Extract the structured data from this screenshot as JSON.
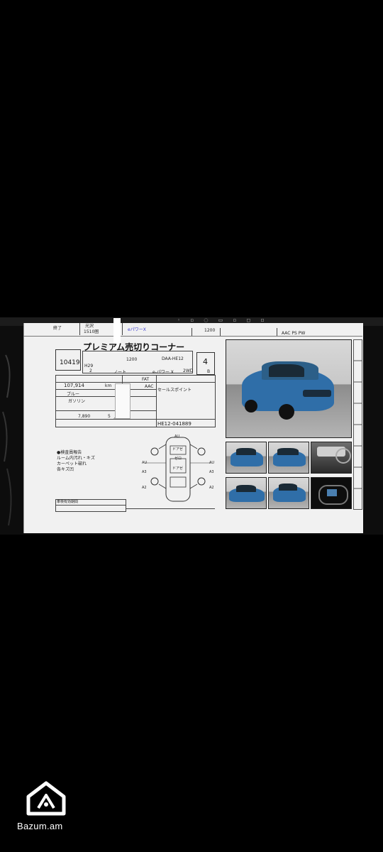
{
  "header": {
    "cell1": "終了",
    "cell2": "光沢",
    "cell3": "1510圏",
    "cell4": "eパワーX",
    "cell5": "1200",
    "equipment": "AAC PS PW"
  },
  "sheet": {
    "lot_number": "10419",
    "title": "プレミアム売切りコーナー",
    "displacement": "1200",
    "model_code": "DAA-HE12",
    "year_label": "H29",
    "month": "2",
    "car_name": "ノート",
    "grade": "e-パワー X",
    "drive": "2WD",
    "score": "4",
    "interior_grade": "B",
    "shift": "FAT",
    "aircon": "AAC",
    "mileage": "107,914",
    "mileage_unit": "km",
    "color": "ブルー",
    "fuel": "ガソリン",
    "recycle_fee": "7,890",
    "capacity": "5",
    "capacity_unit": "人",
    "serial": "HE12-041889",
    "notes_label": "●検査員報告",
    "notes": [
      "ルーム内汚れ・キズ",
      "カーペット破れ",
      "各キズ凹"
    ],
    "seat_check": "セールスポイント",
    "bottom_table_label": "車検有効期間"
  },
  "diagram_labels": {
    "top": "AU",
    "left": [
      "AU",
      "A3",
      "A2"
    ],
    "right": [
      "AU",
      "A3",
      "A2"
    ],
    "panels": [
      "ドアゼ",
      "ゼロ",
      "ドアゼ"
    ]
  },
  "photos": {
    "main_alt": "blue Nissan Note front three-quarter view",
    "thumbs": [
      "front-view",
      "rear-view",
      "interior-dashboard",
      "side-view",
      "rear-three-quarter",
      "instrument-cluster"
    ]
  },
  "watermark": {
    "brand": "Bazum.am"
  }
}
